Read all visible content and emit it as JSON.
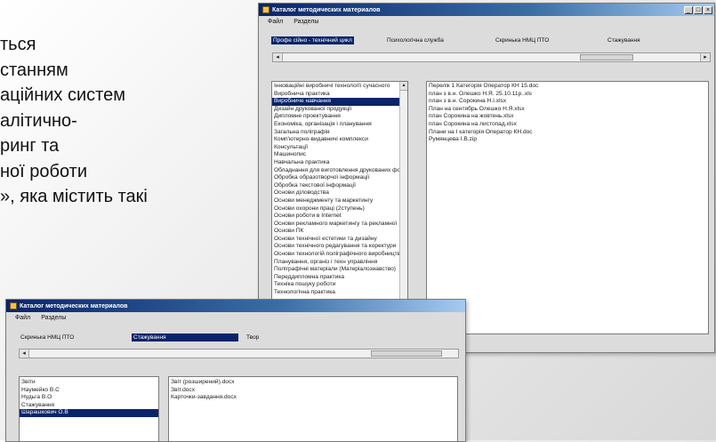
{
  "slide": {
    "lines": [
      "ться",
      "станням",
      "аційних систем",
      "алітично-",
      "ринг та",
      "ної роботи",
      "», яка містить такі"
    ]
  },
  "main_window": {
    "title": "Каталог методических материалов",
    "menu": [
      "Файл",
      "Разделы"
    ],
    "tabs": [
      "Профе сійно - технічний цикл",
      "Психологічна служба",
      "Скринька НМЦ ПТО",
      "Стажування"
    ],
    "selected_tab": 0,
    "controls": {
      "minimize": "_",
      "maximize": "□",
      "close": "×"
    },
    "categories": [
      "Інноваційні виробничі технології сучасного",
      "Виробнича практика",
      "Виробниче навчання",
      "Дизайн друкованої продукції",
      "Дипломне проектування",
      "Економіка, організація і планування",
      "Загальна поліграфія",
      "Комп'ютерно-видавничі комплекси",
      "Консультації",
      "Машинопис",
      "Навчальна практика",
      "Обладнання для виготовлення друкованих форм",
      "Обробка образотворчої інформації",
      "Обробка текстової інформації",
      "Основи діловодства",
      "Основи менеджменту та маркетингу",
      "Основи охорони праці (2ступень)",
      "Основи роботи в Internet",
      "Основи рекламного маркетингу та рекламної",
      "Основи ПК",
      "Основи технічної естетики та дизайну",
      "Основи технічного редагування та коректури",
      "Основи технологій поліграфічного виробництва",
      "Планування, організ і техн управління",
      "Поліграфічні матеріали (Матеріалознавство)",
      "Переддипломна практика",
      "Техніка пошуку роботи",
      "Технологічна практика"
    ],
    "selected_category": 2,
    "files": [
      "Перелік 1 Категорія Оператор КН 15.doc",
      "план з в.н. Олешко Н.Я. 25.10.11р..xls",
      "план з в.н. Сорокина Н.І.xlsx",
      "План на сентябрь Олешко Н.Я.xlsx",
      "план Сорокина на жовтень.xlsx",
      "план Сорокина на листопад.xlsx",
      "Плани на І категорія Оператор КН.doc",
      "Румянцева І.В.zip"
    ]
  },
  "second_window": {
    "title": "Каталог методических материалов",
    "menu": [
      "Файл",
      "Разделы"
    ],
    "tabs": [
      "Скринька НМЦ ПТО",
      "Стажування",
      "Твор"
    ],
    "selected_tab": 1,
    "people": [
      "Звіти",
      "Наумейко В.С",
      "Нудьга В.О",
      "Стажування",
      "Шарашкович О.В"
    ],
    "selected_person": 4,
    "files": [
      "Звіт (розширений).docx",
      "Звіт.docx",
      "Карточки-завдання.docx"
    ]
  },
  "colors": {
    "selection": "#0a246a",
    "titlebar_start": "#0a246a",
    "titlebar_end": "#a6caf0"
  }
}
